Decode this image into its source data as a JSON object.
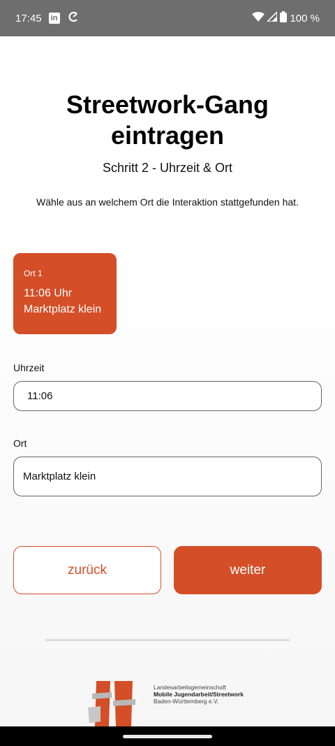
{
  "status_bar": {
    "time": "17:45",
    "battery": "100 %",
    "icons": [
      "linkedin-icon",
      "sync-icon",
      "wifi-icon",
      "cellular-signal-icon",
      "battery-icon"
    ]
  },
  "page": {
    "title_line1": "Streetwork-Gang",
    "title_line2": "eintragen",
    "subtitle": "Schritt 2 - Uhrzeit & Ort",
    "instruction": "Wähle aus an welchem Ort die Interaktion stattgefunden hat."
  },
  "location_card": {
    "label": "Ort 1",
    "time": "11:06 Uhr",
    "place": "Marktplatz klein"
  },
  "form": {
    "time_label": "Uhrzeit",
    "time_value": "11:06",
    "place_label": "Ort",
    "place_value": "Marktplatz klein"
  },
  "buttons": {
    "back_label": "zurück",
    "next_label": "weiter"
  },
  "footer_logo": {
    "line1": "Landesarbeitsgemeinschaft",
    "line2": "Mobile Jugendarbeit/Streetwork",
    "line3": "Baden-Württemberg e.V."
  },
  "colors": {
    "accent": "#d44e27",
    "status_bar": "#6e6e6e"
  }
}
